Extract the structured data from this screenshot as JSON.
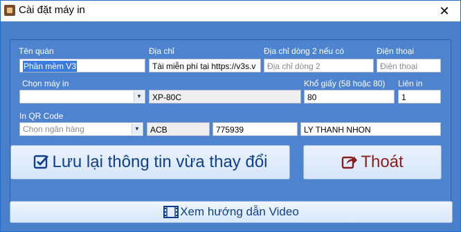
{
  "window": {
    "title": "Cài đặt máy in",
    "close_glyph": "✕"
  },
  "labels": {
    "shop_name": "Tên quán",
    "address": "Địa chỉ",
    "address2": "Địa chỉ dòng 2 nếu có",
    "phone": "Điện thoại",
    "printer": "Chọn máy in",
    "paper_size": "Khổ giấy (58 hoặc 80)",
    "copies": "Liên in",
    "qr": "In QR Code"
  },
  "fields": {
    "shop_name": "Phần mềm V3",
    "address": "Tài miễn phí tại https://v3s.v",
    "address2_placeholder": "Địa chỉ dòng 2",
    "phone_placeholder": "Điện thoại",
    "printer_value": "",
    "printer_name": "XP-80C",
    "paper_size": "80",
    "copies": "1",
    "bank_placeholder": "Chọn ngân hàng",
    "bank_code": "ACB",
    "account_number": "775939",
    "account_name": "LY THANH NHON"
  },
  "buttons": {
    "save": "Lưu lại thông tin vừa thay đổi",
    "exit": "Thoát",
    "video": "Xem hướng dẫn Video"
  },
  "icons": {
    "save": "checkbox-icon",
    "exit": "exit-share-icon",
    "video": "film-icon",
    "app": "app-icon"
  },
  "colors": {
    "background": "#4a7fc9",
    "save_text": "#103f8c",
    "exit_text": "#8a1e1e"
  }
}
